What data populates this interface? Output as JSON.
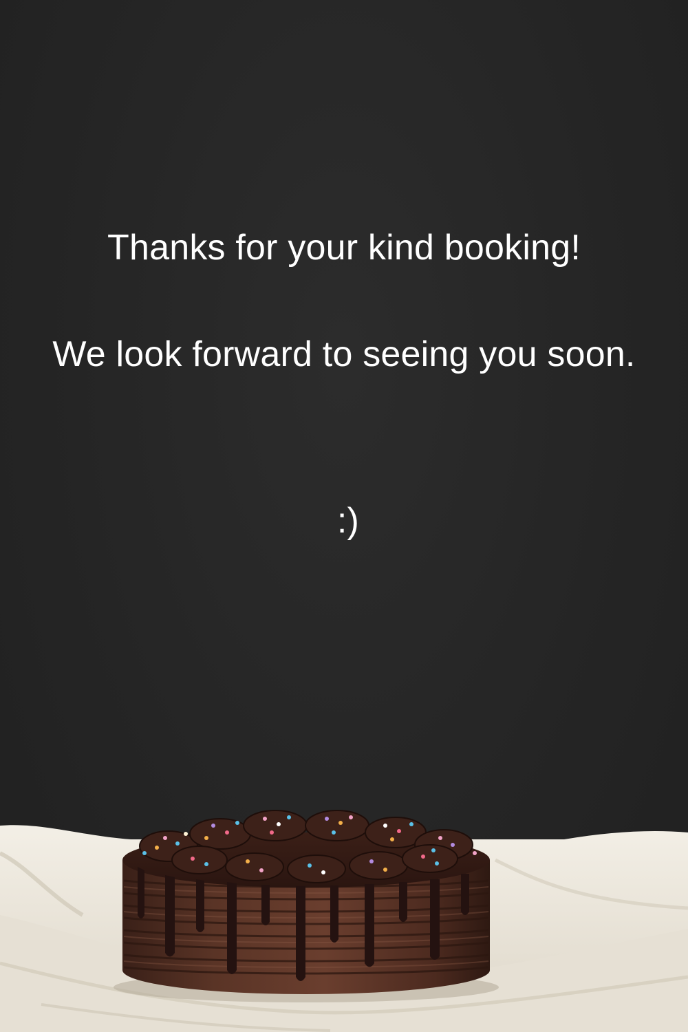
{
  "message": {
    "line1": "Thanks for your kind booking!",
    "line2": "We look forward to seeing you soon.",
    "line3": ":)"
  },
  "colors": {
    "background": "#262626",
    "text": "#ffffff",
    "cloth": "#ece7dc",
    "cake": "#4a2a1f",
    "ganache": "#2a1410"
  }
}
